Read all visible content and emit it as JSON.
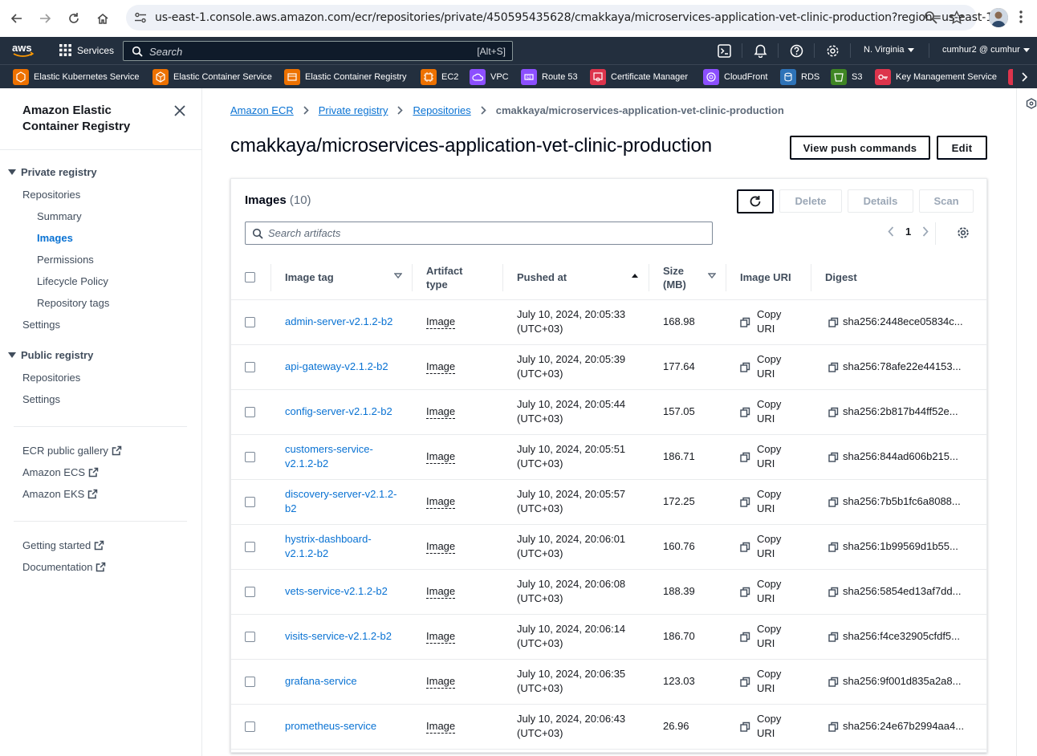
{
  "browser": {
    "url": "us-east-1.console.aws.amazon.com/ecr/repositories/private/450595435628/cmakkaya/microservices-application-vet-clinic-production?region=us-east-1"
  },
  "topbar": {
    "services_label": "Services",
    "search_placeholder": "Search",
    "search_shortcut": "[Alt+S]",
    "region": "N. Virginia",
    "account": "cumhur2 @ cumhur"
  },
  "favorites": [
    {
      "label": "Elastic Kubernetes Service",
      "color": "#ed7100"
    },
    {
      "label": "Elastic Container Service",
      "color": "#ed7100"
    },
    {
      "label": "Elastic Container Registry",
      "color": "#ed7100"
    },
    {
      "label": "EC2",
      "color": "#ed7100"
    },
    {
      "label": "VPC",
      "color": "#8c4fff"
    },
    {
      "label": "Route 53",
      "color": "#8c4fff"
    },
    {
      "label": "Certificate Manager",
      "color": "#dd344c"
    },
    {
      "label": "CloudFront",
      "color": "#8c4fff"
    },
    {
      "label": "RDS",
      "color": "#2e73b8"
    },
    {
      "label": "S3",
      "color": "#3f8624"
    },
    {
      "label": "Key Management Service",
      "color": "#dd344c"
    }
  ],
  "sidebar": {
    "title": "Amazon Elastic Container Registry",
    "private_section": "Private registry",
    "private_items": [
      "Repositories",
      "Summary",
      "Images",
      "Permissions",
      "Lifecycle Policy",
      "Repository tags",
      "Settings"
    ],
    "public_section": "Public registry",
    "public_items": [
      "Repositories",
      "Settings"
    ],
    "external_links": [
      "ECR public gallery",
      "Amazon ECS",
      "Amazon EKS"
    ],
    "help_links": [
      "Getting started",
      "Documentation"
    ]
  },
  "breadcrumb": [
    "Amazon ECR",
    "Private registry",
    "Repositories",
    "cmakkaya/microservices-application-vet-clinic-production"
  ],
  "page": {
    "title": "cmakkaya/microservices-application-vet-clinic-production",
    "view_push_label": "View push commands",
    "edit_label": "Edit"
  },
  "images": {
    "title": "Images",
    "count": "(10)",
    "delete_label": "Delete",
    "details_label": "Details",
    "scan_label": "Scan",
    "filter_placeholder": "Search artifacts",
    "current_page": "1",
    "columns": [
      "Image tag",
      "Artifact type",
      "Pushed at",
      "Size (MB)",
      "Image URI",
      "Digest"
    ],
    "rows": [
      {
        "tag": "admin-server-v2.1.2-b2",
        "type": "Image",
        "pushed": "July 10, 2024, 20:05:33 (UTC+03)",
        "size": "168.98",
        "uri": "Copy URI",
        "digest": "sha256:2448ece05834c..."
      },
      {
        "tag": "api-gateway-v2.1.2-b2",
        "type": "Image",
        "pushed": "July 10, 2024, 20:05:39 (UTC+03)",
        "size": "177.64",
        "uri": "Copy URI",
        "digest": "sha256:78afe22e44153..."
      },
      {
        "tag": "config-server-v2.1.2-b2",
        "type": "Image",
        "pushed": "July 10, 2024, 20:05:44 (UTC+03)",
        "size": "157.05",
        "uri": "Copy URI",
        "digest": "sha256:2b817b44ff52e..."
      },
      {
        "tag": "customers-service-v2.1.2-b2",
        "type": "Image",
        "pushed": "July 10, 2024, 20:05:51 (UTC+03)",
        "size": "186.71",
        "uri": "Copy URI",
        "digest": "sha256:844ad606b215..."
      },
      {
        "tag": "discovery-server-v2.1.2-b2",
        "type": "Image",
        "pushed": "July 10, 2024, 20:05:57 (UTC+03)",
        "size": "172.25",
        "uri": "Copy URI",
        "digest": "sha256:7b5b1fc6a8088..."
      },
      {
        "tag": "hystrix-dashboard-v2.1.2-b2",
        "type": "Image",
        "pushed": "July 10, 2024, 20:06:01 (UTC+03)",
        "size": "160.76",
        "uri": "Copy URI",
        "digest": "sha256:1b99569d1b55..."
      },
      {
        "tag": "vets-service-v2.1.2-b2",
        "type": "Image",
        "pushed": "July 10, 2024, 20:06:08 (UTC+03)",
        "size": "188.39",
        "uri": "Copy URI",
        "digest": "sha256:5854ed13af7dd..."
      },
      {
        "tag": "visits-service-v2.1.2-b2",
        "type": "Image",
        "pushed": "July 10, 2024, 20:06:14 (UTC+03)",
        "size": "186.70",
        "uri": "Copy URI",
        "digest": "sha256:f4ce32905cfdf5..."
      },
      {
        "tag": "grafana-service",
        "type": "Image",
        "pushed": "July 10, 2024, 20:06:35 (UTC+03)",
        "size": "123.03",
        "uri": "Copy URI",
        "digest": "sha256:9f001d835a2a8..."
      },
      {
        "tag": "prometheus-service",
        "type": "Image",
        "pushed": "July 10, 2024, 20:06:43 (UTC+03)",
        "size": "26.96",
        "uri": "Copy URI",
        "digest": "sha256:24e67b2994aa4..."
      }
    ]
  },
  "colors": {
    "aws_nav": "#232f3e",
    "link": "#0972d3",
    "text": "#16191f",
    "border": "#e9ebed"
  }
}
